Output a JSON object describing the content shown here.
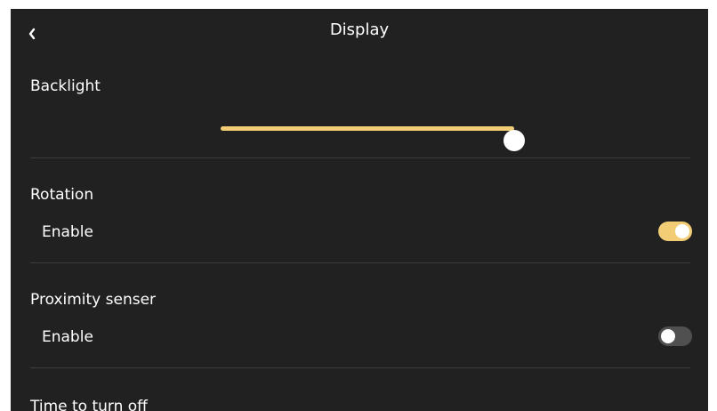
{
  "header": {
    "title": "Display",
    "back_icon": "chevron-left-icon"
  },
  "backlight": {
    "title": "Backlight",
    "level_percent": 100,
    "fill_color": "#f2cd75",
    "track_color": "#555555"
  },
  "rotation": {
    "title": "Rotation",
    "enable_label": "Enable",
    "enabled": true
  },
  "proximity": {
    "title": "Proximity senser",
    "enable_label": "Enable",
    "enabled": false
  },
  "time_to_turn_off": {
    "title": "Time to turn off"
  },
  "colors": {
    "background": "#212121",
    "accent": "#f2cd75",
    "toggle_off": "#505050",
    "divider": "#3c3c3c",
    "text": "#ffffff"
  }
}
